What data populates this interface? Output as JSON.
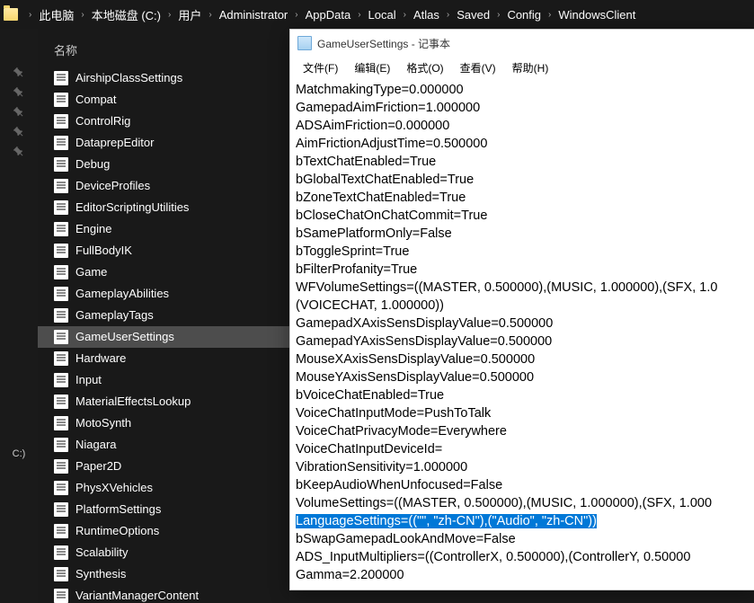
{
  "breadcrumb": {
    "items": [
      "此电脑",
      "本地磁盘 (C:)",
      "用户",
      "Administrator",
      "AppData",
      "Local",
      "Atlas",
      "Saved",
      "Config",
      "WindowsClient"
    ]
  },
  "gutter": {
    "drive_label": "C:)"
  },
  "file_panel": {
    "column_header": "名称",
    "files": [
      "AirshipClassSettings",
      "Compat",
      "ControlRig",
      "DataprepEditor",
      "Debug",
      "DeviceProfiles",
      "EditorScriptingUtilities",
      "Engine",
      "FullBodyIK",
      "Game",
      "GameplayAbilities",
      "GameplayTags",
      "GameUserSettings",
      "Hardware",
      "Input",
      "MaterialEffectsLookup",
      "MotoSynth",
      "Niagara",
      "Paper2D",
      "PhysXVehicles",
      "PlatformSettings",
      "RuntimeOptions",
      "Scalability",
      "Synthesis",
      "VariantManagerContent"
    ],
    "selected_index": 12
  },
  "notepad": {
    "title": "GameUserSettings - 记事本",
    "menu": {
      "file": "文件(F)",
      "edit": "编辑(E)",
      "format": "格式(O)",
      "view": "查看(V)",
      "help": "帮助(H)"
    },
    "lines": [
      "MatchmakingType=0.000000",
      "GamepadAimFriction=1.000000",
      "ADSAimFriction=0.000000",
      "AimFrictionAdjustTime=0.500000",
      "bTextChatEnabled=True",
      "bGlobalTextChatEnabled=True",
      "bZoneTextChatEnabled=True",
      "bCloseChatOnChatCommit=True",
      "bSamePlatformOnly=False",
      "bToggleSprint=True",
      "bFilterProfanity=True",
      "WFVolumeSettings=((MASTER, 0.500000),(MUSIC, 1.000000),(SFX, 1.0",
      "(VOICECHAT, 1.000000))",
      "GamepadXAxisSensDisplayValue=0.500000",
      "GamepadYAxisSensDisplayValue=0.500000",
      "MouseXAxisSensDisplayValue=0.500000",
      "MouseYAxisSensDisplayValue=0.500000",
      "bVoiceChatEnabled=True",
      "VoiceChatInputMode=PushToTalk",
      "VoiceChatPrivacyMode=Everywhere",
      "VoiceChatInputDeviceId=",
      "VibrationSensitivity=1.000000",
      "bKeepAudioWhenUnfocused=False",
      "VolumeSettings=((MASTER, 0.500000),(MUSIC, 1.000000),(SFX, 1.000",
      "LanguageSettings=((\"\", \"zh-CN\"),(\"Audio\", \"zh-CN\"))",
      "bSwapGamepadLookAndMove=False",
      "ADS_InputMultipliers=((ControllerX, 0.500000),(ControllerY, 0.50000",
      "Gamma=2.200000"
    ],
    "highlighted_line_index": 24
  }
}
